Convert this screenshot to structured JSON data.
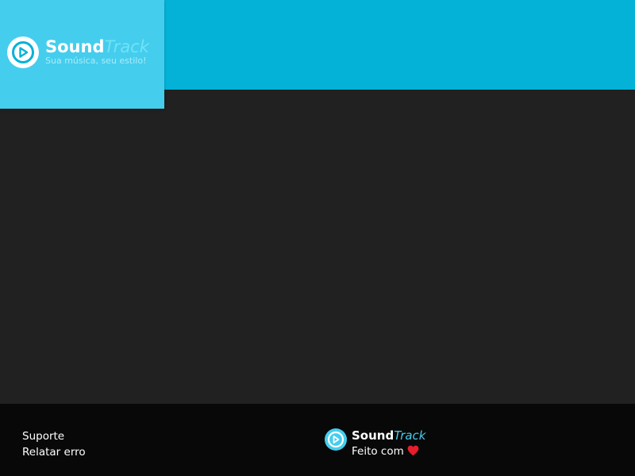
{
  "header": {
    "brand_part1": "Sound",
    "brand_part2": "Track",
    "tagline": "Sua música, seu estilo!",
    "logo_icon": "play-circle-icon"
  },
  "footer": {
    "links": [
      {
        "label": "Suporte"
      },
      {
        "label": "Relatar erro"
      }
    ],
    "brand_part1": "Sound",
    "brand_part2": "Track",
    "made_with": "Feito com",
    "heart_icon": "heart-icon"
  },
  "colors": {
    "header_bg": "#04B2D7",
    "logo_card_bg": "#45CDEE",
    "main_bg": "#212121",
    "footer_bg": "#080808",
    "heart": "#E41E2B"
  }
}
